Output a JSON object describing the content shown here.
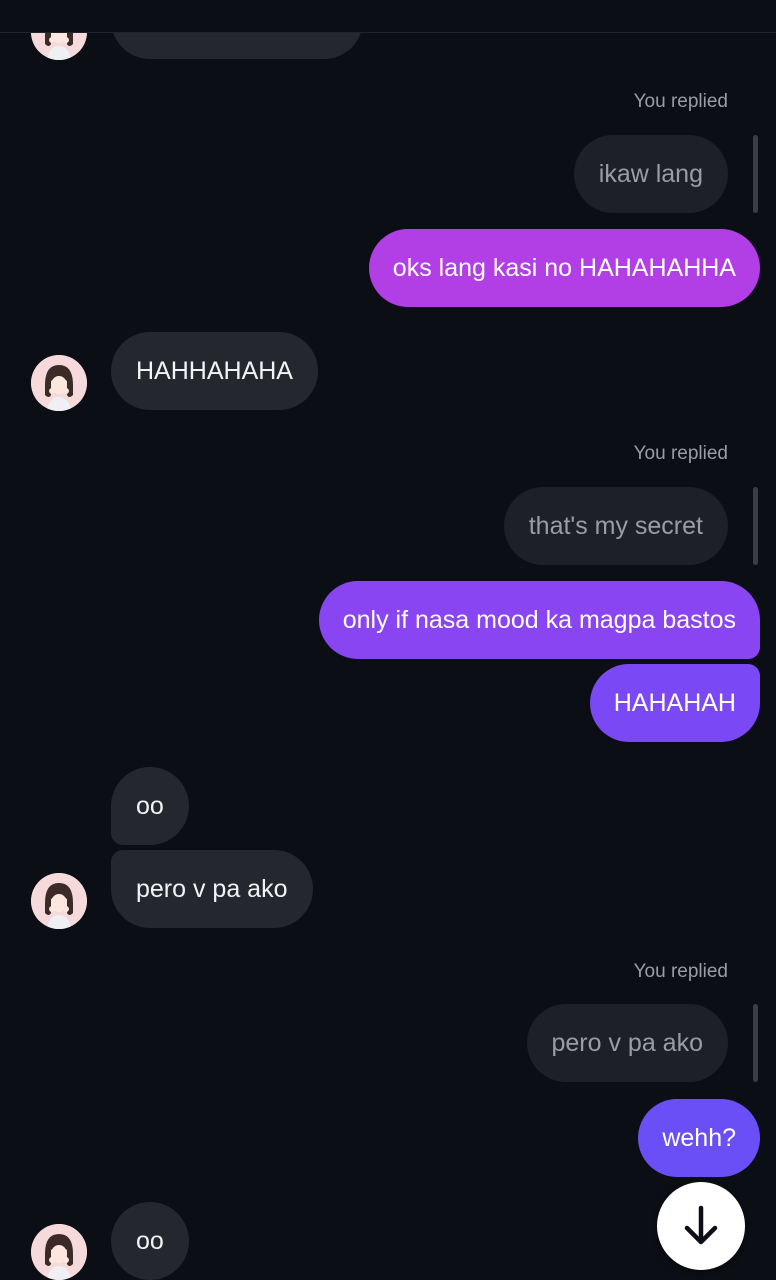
{
  "conversation": {
    "reply_label": "You replied",
    "messages": [
      {
        "text": ""
      },
      {
        "text": "ikaw lang"
      },
      {
        "text": "oks lang kasi no HAHAHAHHA"
      },
      {
        "text": "HAHHAHAHA"
      },
      {
        "text": "that's my secret"
      },
      {
        "text": "only if nasa mood ka magpa bastos"
      },
      {
        "text": "HAHAHAH"
      },
      {
        "text": "oo"
      },
      {
        "text": "pero v pa ako"
      },
      {
        "text": "pero v pa ako"
      },
      {
        "text": "wehh?"
      },
      {
        "text": "oo"
      }
    ]
  },
  "colors": {
    "background": "#0b0e14",
    "incoming_bubble": "#24272e",
    "quoted_bubble": "#1d2027",
    "outgoing_gradient_top": "#b23ee6",
    "outgoing_gradient_mid": "#8a45f2",
    "outgoing_gradient_bottom": "#6a4ff6"
  },
  "scroll_button": {
    "icon": "arrow-down-icon"
  }
}
